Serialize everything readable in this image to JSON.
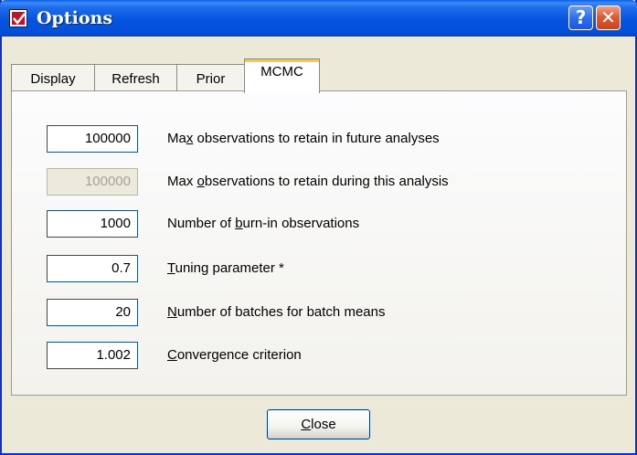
{
  "window": {
    "title": "Options"
  },
  "titlebar_buttons": {
    "help": "?",
    "close": "✕"
  },
  "tabs": [
    {
      "label": "Display"
    },
    {
      "label": "Refresh"
    },
    {
      "label": "Prior"
    },
    {
      "label": "MCMC",
      "selected": true
    }
  ],
  "fields": [
    {
      "value": "100000",
      "label_pre": "Ma",
      "label_ul": "x",
      "label_post": " observations to retain in future analyses",
      "disabled": false
    },
    {
      "value": "100000",
      "label_pre": "Max ",
      "label_ul": "o",
      "label_post": "bservations to retain during this analysis",
      "disabled": true
    },
    {
      "value": "1000",
      "label_pre": "Number of ",
      "label_ul": "b",
      "label_post": "urn-in observations",
      "disabled": false
    },
    {
      "value": "0.7",
      "label_pre": "",
      "label_ul": "T",
      "label_post": "uning parameter *",
      "disabled": false
    },
    {
      "value": "20",
      "label_pre": "",
      "label_ul": "N",
      "label_post": "umber of batches for batch means",
      "disabled": false
    },
    {
      "value": "1.002",
      "label_pre": "",
      "label_ul": "C",
      "label_post": "onvergence criterion",
      "disabled": false
    }
  ],
  "close_button": {
    "label_ul": "C",
    "label_post": "lose"
  },
  "colors": {
    "titlebar": "#0553e0",
    "window_bg": "#ece9d8",
    "active_tab_accent": "#ffc83c",
    "close_btn": "#e35a32"
  },
  "icons": {
    "app": "checkbox-app-icon",
    "help": "question-mark-icon",
    "close": "close-x-icon"
  }
}
